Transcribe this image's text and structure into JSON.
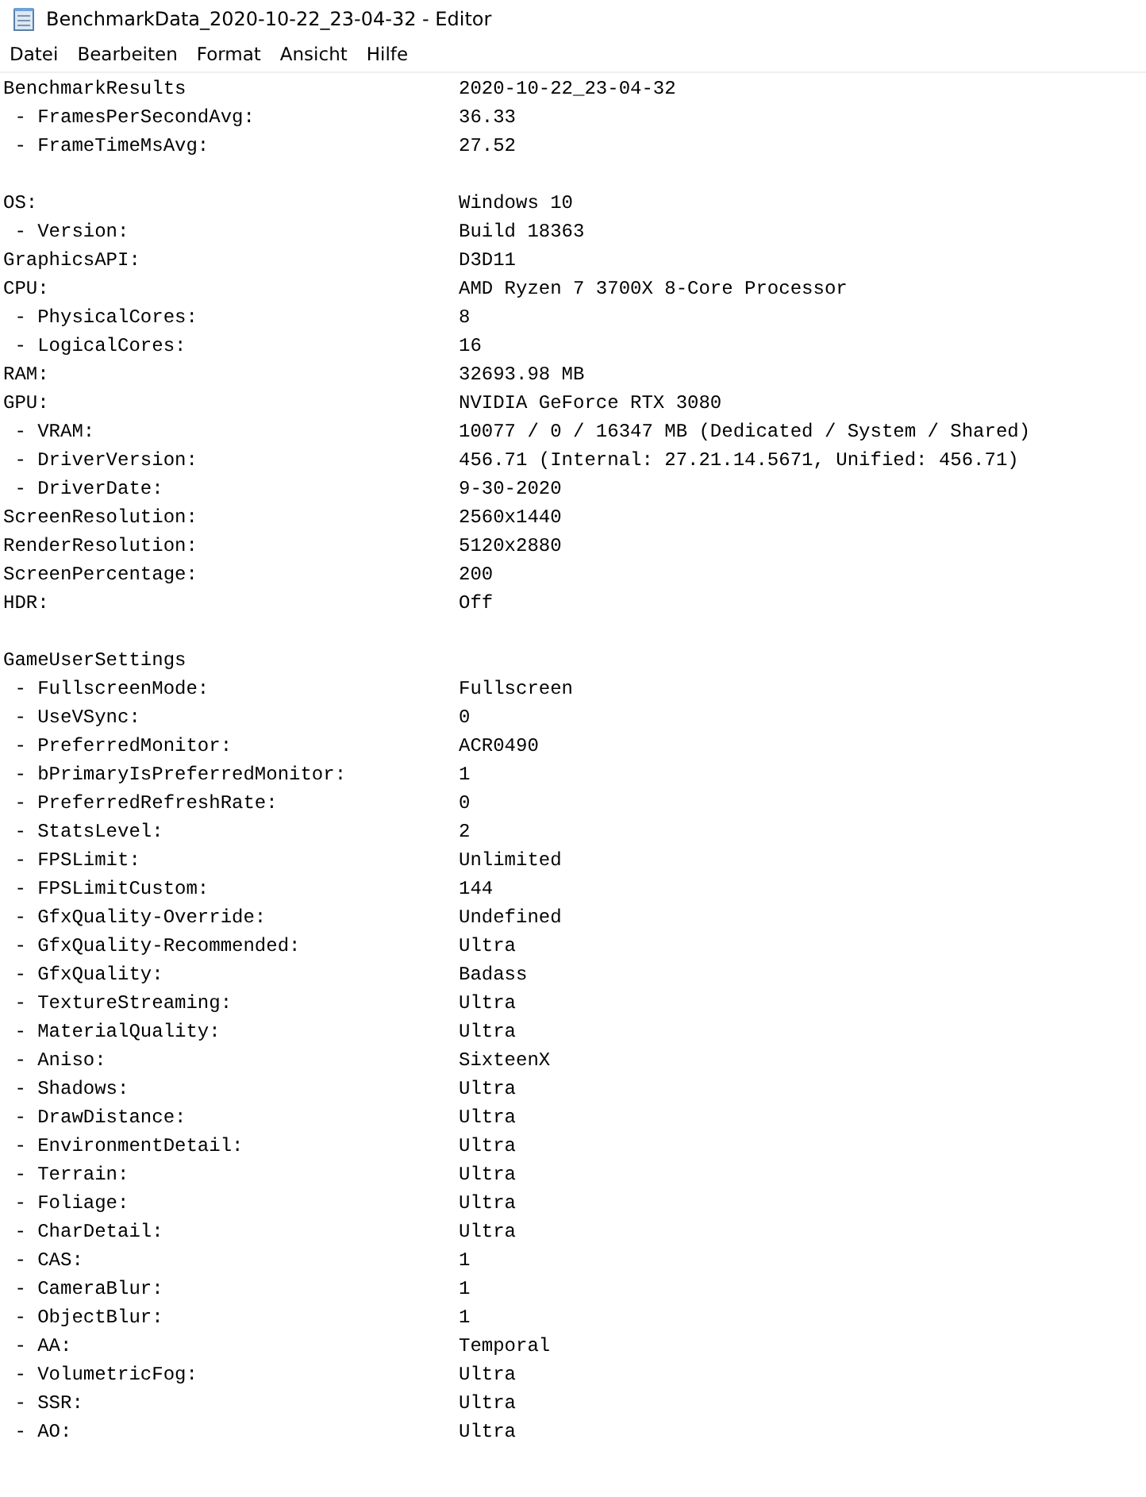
{
  "window": {
    "title": "BenchmarkData_2020-10-22_23-04-32 - Editor"
  },
  "menu": [
    "Datei",
    "Bearbeiten",
    "Format",
    "Ansicht",
    "Hilfe"
  ],
  "lines": [
    {
      "kind": "entry",
      "key": "BenchmarkResults",
      "value": "2020-10-22_23-04-32"
    },
    {
      "kind": "entry",
      "key": " - FramesPerSecondAvg:",
      "value": "36.33"
    },
    {
      "kind": "entry",
      "key": " - FrameTimeMsAvg:",
      "value": "27.52"
    },
    {
      "kind": "blank"
    },
    {
      "kind": "entry",
      "key": "OS:",
      "value": "Windows 10"
    },
    {
      "kind": "entry",
      "key": " - Version:",
      "value": "Build 18363"
    },
    {
      "kind": "entry",
      "key": "GraphicsAPI:",
      "value": "D3D11"
    },
    {
      "kind": "entry",
      "key": "CPU:",
      "value": "AMD Ryzen 7 3700X 8-Core Processor"
    },
    {
      "kind": "entry",
      "key": " - PhysicalCores:",
      "value": "8"
    },
    {
      "kind": "entry",
      "key": " - LogicalCores:",
      "value": "16"
    },
    {
      "kind": "entry",
      "key": "RAM:",
      "value": "32693.98 MB"
    },
    {
      "kind": "entry",
      "key": "GPU:",
      "value": "NVIDIA GeForce RTX 3080"
    },
    {
      "kind": "entry",
      "key": " - VRAM:",
      "value": "10077 / 0 / 16347 MB (Dedicated / System / Shared)"
    },
    {
      "kind": "entry",
      "key": " - DriverVersion:",
      "value": "456.71 (Internal: 27.21.14.5671, Unified: 456.71)"
    },
    {
      "kind": "entry",
      "key": " - DriverDate:",
      "value": "9-30-2020"
    },
    {
      "kind": "entry",
      "key": "ScreenResolution:",
      "value": "2560x1440"
    },
    {
      "kind": "entry",
      "key": "RenderResolution:",
      "value": "5120x2880"
    },
    {
      "kind": "entry",
      "key": "ScreenPercentage:",
      "value": "200"
    },
    {
      "kind": "entry",
      "key": "HDR:",
      "value": "Off"
    },
    {
      "kind": "blank"
    },
    {
      "kind": "entry",
      "key": "GameUserSettings"
    },
    {
      "kind": "entry",
      "key": " - FullscreenMode:",
      "value": "Fullscreen"
    },
    {
      "kind": "entry",
      "key": " - UseVSync:",
      "value": "0"
    },
    {
      "kind": "entry",
      "key": " - PreferredMonitor:",
      "value": "ACR0490"
    },
    {
      "kind": "entry",
      "key": " - bPrimaryIsPreferredMonitor:",
      "value": "1"
    },
    {
      "kind": "entry",
      "key": " - PreferredRefreshRate:",
      "value": "0"
    },
    {
      "kind": "entry",
      "key": " - StatsLevel:",
      "value": "2"
    },
    {
      "kind": "entry",
      "key": " - FPSLimit:",
      "value": "Unlimited"
    },
    {
      "kind": "entry",
      "key": " - FPSLimitCustom:",
      "value": "144"
    },
    {
      "kind": "entry",
      "key": " - GfxQuality-Override:",
      "value": "Undefined"
    },
    {
      "kind": "entry",
      "key": " - GfxQuality-Recommended:",
      "value": "Ultra"
    },
    {
      "kind": "entry",
      "key": " - GfxQuality:",
      "value": "Badass"
    },
    {
      "kind": "entry",
      "key": " - TextureStreaming:",
      "value": "Ultra"
    },
    {
      "kind": "entry",
      "key": " - MaterialQuality:",
      "value": "Ultra"
    },
    {
      "kind": "entry",
      "key": " - Aniso:",
      "value": "SixteenX"
    },
    {
      "kind": "entry",
      "key": " - Shadows:",
      "value": "Ultra"
    },
    {
      "kind": "entry",
      "key": " - DrawDistance:",
      "value": "Ultra"
    },
    {
      "kind": "entry",
      "key": " - EnvironmentDetail:",
      "value": "Ultra"
    },
    {
      "kind": "entry",
      "key": " - Terrain:",
      "value": "Ultra"
    },
    {
      "kind": "entry",
      "key": " - Foliage:",
      "value": "Ultra"
    },
    {
      "kind": "entry",
      "key": " - CharDetail:",
      "value": "Ultra"
    },
    {
      "kind": "entry",
      "key": " - CAS:",
      "value": "1"
    },
    {
      "kind": "entry",
      "key": " - CameraBlur:",
      "value": "1"
    },
    {
      "kind": "entry",
      "key": " - ObjectBlur:",
      "value": "1"
    },
    {
      "kind": "entry",
      "key": " - AA:",
      "value": "Temporal"
    },
    {
      "kind": "entry",
      "key": " - VolumetricFog:",
      "value": "Ultra"
    },
    {
      "kind": "entry",
      "key": " - SSR:",
      "value": "Ultra"
    },
    {
      "kind": "entry",
      "key": " - AO:",
      "value": "Ultra"
    }
  ]
}
